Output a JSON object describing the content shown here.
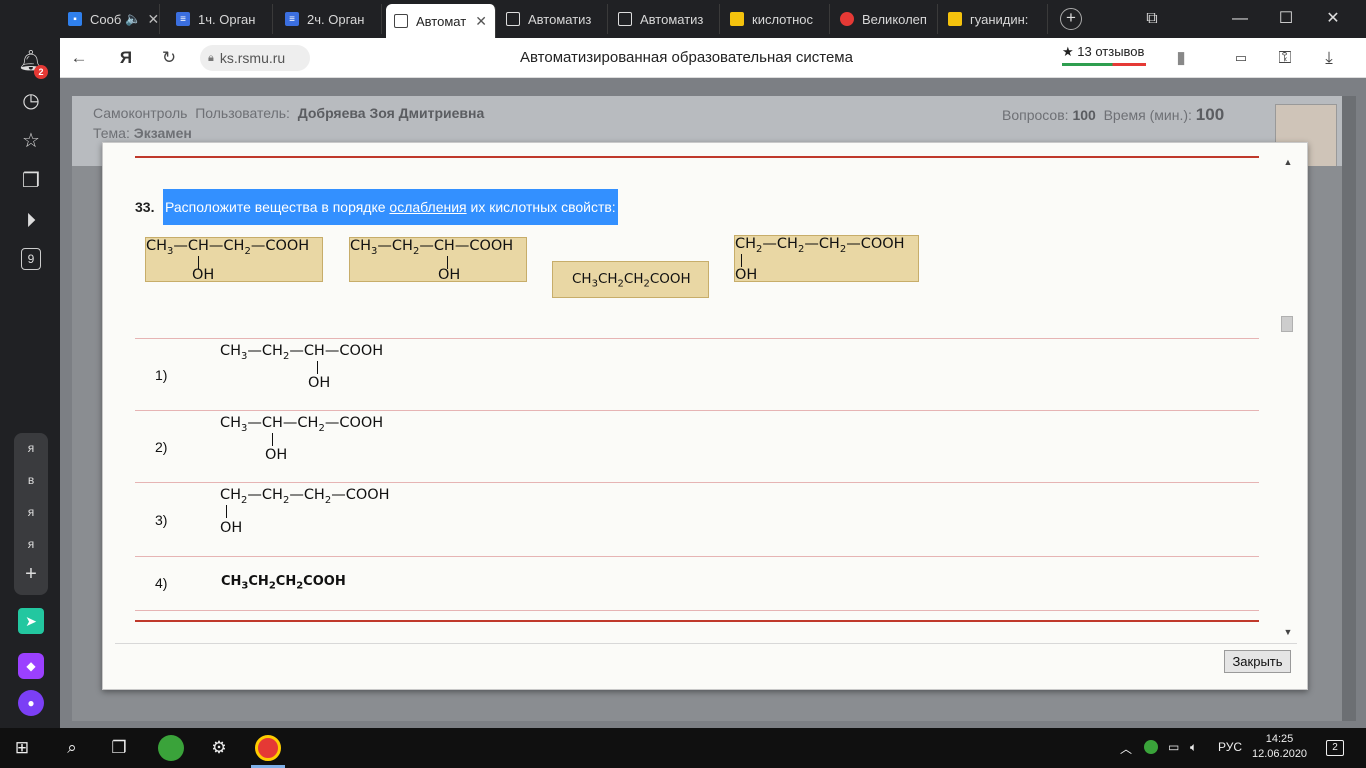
{
  "browser": {
    "tabs": [
      {
        "label": "Сооб",
        "favicon_color": "#2f80ed",
        "extra": "🔈"
      },
      {
        "label": "1ч. Орган",
        "favicon_color": "#3b6fe0"
      },
      {
        "label": "2ч. Орган",
        "favicon_color": "#3b6fe0"
      },
      {
        "label": "Автомат",
        "favicon_color": "#ffffff"
      },
      {
        "label": "Автоматиз",
        "favicon_color": "#ffffff"
      },
      {
        "label": "Автоматиз",
        "favicon_color": "#ffffff"
      },
      {
        "label": "кислотнос",
        "favicon_color": "#f4c20d"
      },
      {
        "label": "Великолеп",
        "favicon_color": "#e53935"
      },
      {
        "label": "гуанидин:",
        "favicon_color": "#f4c20d"
      }
    ],
    "url": "ks.rsmu.ru",
    "page_title": "Автоматизированная образовательная система",
    "reviews": "★ 13 отзывов"
  },
  "sidebar": {
    "notification_count": "2",
    "tab_count": "9",
    "letters": [
      "я",
      "в",
      "я",
      "я"
    ]
  },
  "page": {
    "info_left": {
      "mode": "Самоконтроль",
      "user_label": "Пользователь:",
      "user_name": "Добряева Зоя Дмитриевна",
      "topic_label": "Тема:",
      "topic": "Экзамен"
    },
    "info_right": {
      "questions_label": "Вопросов:",
      "questions": "100",
      "time_label": "Время (мин.):",
      "time": "100"
    }
  },
  "question": {
    "number": "33.",
    "text_before": "Расположите вещества в порядке ",
    "text_underlined": "ослабления",
    "text_after": " их кислотных свойств:",
    "options": [
      {
        "num": "1)"
      },
      {
        "num": "2)"
      },
      {
        "num": "3)"
      },
      {
        "num": "4)"
      }
    ],
    "close_label": "Закрыть"
  },
  "taskbar": {
    "language": "РУС",
    "time": "14:25",
    "date": "12.06.2020",
    "notifications": "2"
  }
}
